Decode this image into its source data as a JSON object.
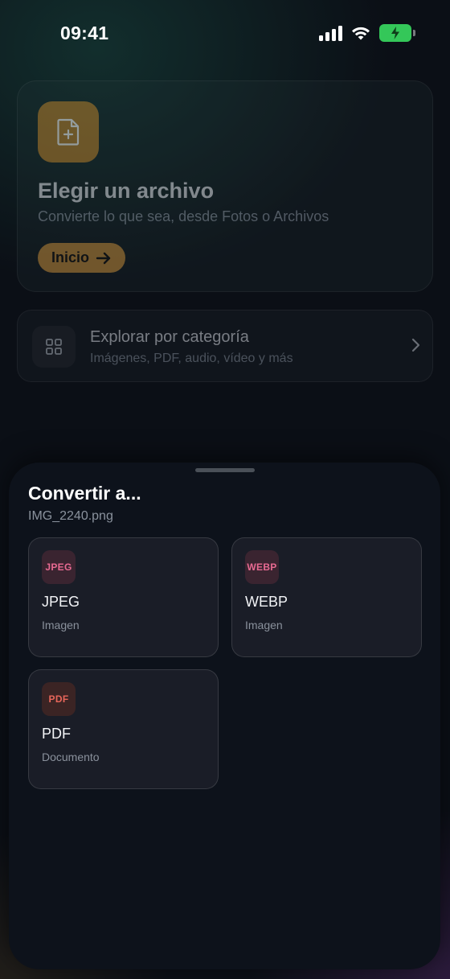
{
  "status_bar": {
    "time": "09:41",
    "icons": [
      "cellular-signal-icon",
      "wifi-icon",
      "battery-charging-icon"
    ]
  },
  "hero": {
    "icon": "file-add-icon",
    "title": "Elegir un archivo",
    "subtitle": "Convierte lo que sea, desde Fotos o Archivos",
    "button_label": "Inicio",
    "button_icon": "arrow-right-icon",
    "accent_color": "#c58f3e"
  },
  "explore": {
    "icon": "grid-icon",
    "title": "Explorar por categoría",
    "subtitle": "Imágenes, PDF, audio, vídeo y más",
    "chevron": "chevron-right-icon"
  },
  "sheet": {
    "title": "Convertir a...",
    "filename": "IMG_2240.png",
    "formats": [
      {
        "badge": "JPEG",
        "name": "JPEG",
        "type": "Imagen",
        "color": "#e86a92"
      },
      {
        "badge": "WEBP",
        "name": "WEBP",
        "type": "Imagen",
        "color": "#e86a92"
      },
      {
        "badge": "PDF",
        "name": "PDF",
        "type": "Documento",
        "color": "#e8665a"
      }
    ]
  }
}
